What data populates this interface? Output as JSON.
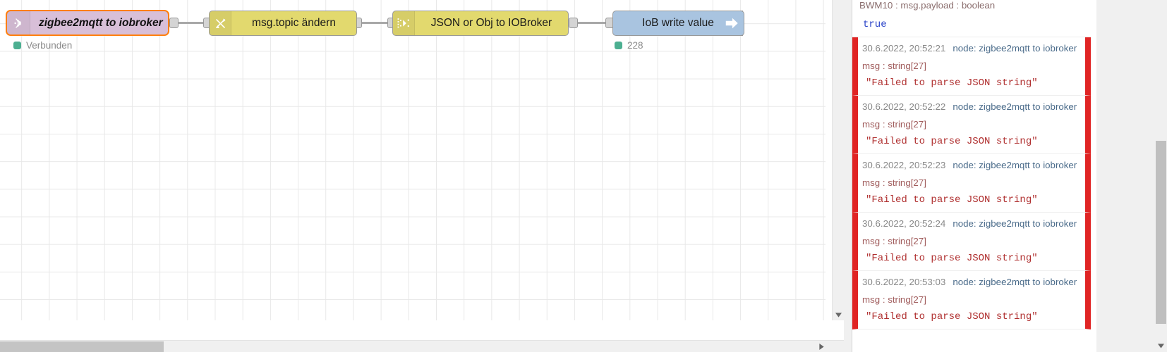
{
  "flow": {
    "nodes": [
      {
        "id": "mqtt-in",
        "label": "zigbee2mqtt to iobroker",
        "icon": "mqtt-signal-icon",
        "color": "#d8bfd8",
        "selected": true,
        "status": {
          "text": "Verbunden",
          "dot_color": "#4caf91"
        }
      },
      {
        "id": "change",
        "label": "msg.topic ändern",
        "icon": "swap-arrows-icon",
        "color": "#e2d96e"
      },
      {
        "id": "json",
        "label": "JSON or Obj to IOBroker",
        "icon": "json-convert-icon",
        "color": "#e2d96e"
      },
      {
        "id": "iob-write",
        "label": "IoB write value",
        "icon": "arrow-right-icon",
        "color": "#a9c4e0",
        "status": {
          "text": "228",
          "dot_color": "#4caf91"
        }
      }
    ]
  },
  "debug": {
    "messages": [
      {
        "header_partial": "BWM10 : msg.payload : boolean",
        "value": "true",
        "value_type": "boolean",
        "error": false
      },
      {
        "timestamp": "30.6.2022, 20:52:21",
        "node": "node: zigbee2mqtt to iobroker",
        "property": "msg : string[27]",
        "value": "\"Failed to parse JSON string\"",
        "error": true
      },
      {
        "timestamp": "30.6.2022, 20:52:22",
        "node": "node: zigbee2mqtt to iobroker",
        "property": "msg : string[27]",
        "value": "\"Failed to parse JSON string\"",
        "error": true
      },
      {
        "timestamp": "30.6.2022, 20:52:23",
        "node": "node: zigbee2mqtt to iobroker",
        "property": "msg : string[27]",
        "value": "\"Failed to parse JSON string\"",
        "error": true
      },
      {
        "timestamp": "30.6.2022, 20:52:24",
        "node": "node: zigbee2mqtt to iobroker",
        "property": "msg : string[27]",
        "value": "\"Failed to parse JSON string\"",
        "error": true
      },
      {
        "timestamp": "30.6.2022, 20:53:03",
        "node": "node: zigbee2mqtt to iobroker",
        "property": "msg : string[27]",
        "value": "\"Failed to parse JSON string\"",
        "error": true
      }
    ]
  },
  "colors": {
    "selection": "#ff7f0e",
    "error": "#e02424",
    "status_ok": "#4caf91"
  }
}
